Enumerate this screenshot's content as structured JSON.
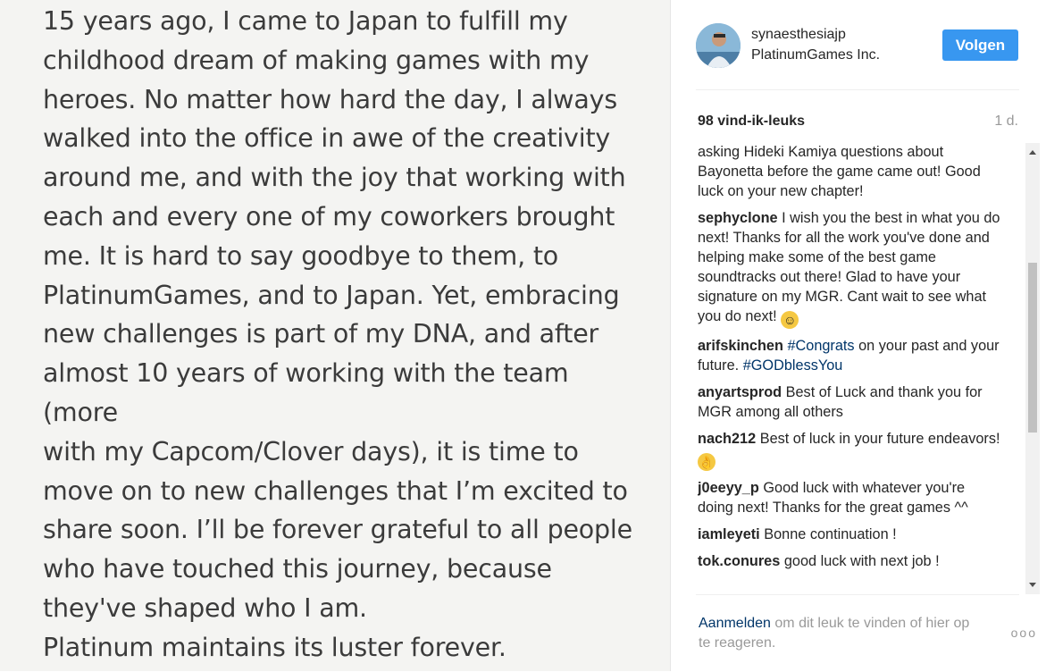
{
  "post": {
    "paragraph1": "15 years ago, I came to Japan to fulfill my\nchildhood dream of making games with my\nheroes. No matter how hard the day, I always\nwalked into the office in awe of the creativity\naround me, and with the joy that working with\neach and every one of my coworkers brought\nme. It is hard to say goodbye to them, to\nPlatinumGames, and to Japan. Yet, embracing\nnew challenges is part of my DNA, and after\nalmost 10 years of working with the team (more\nwith my Capcom/Clover days), it is time to\nmove on to new challenges that I’m excited to\nshare soon. I’ll be forever grateful to all people\nwho have touched this journey, because\nthey've shaped who I am.",
    "paragraph2": "Platinum maintains its luster forever."
  },
  "header": {
    "username": "synaesthesiajp",
    "location": "PlatinumGames Inc.",
    "follow_label": "Volgen"
  },
  "stats": {
    "likes": "98 vind-ik-leuks",
    "ago": "1 d."
  },
  "comments": [
    {
      "user": "",
      "text": "asking Hideki Kamiya questions about Bayonetta before the game came out! Good luck on your new chapter!"
    },
    {
      "user": "sephyclone",
      "text": "I wish you the best in what you do next! Thanks for all the work you've done and helping make some of the best game soundtracks out there! Glad to have your signature on my MGR. Cant wait to see what you do next!"
    },
    {
      "user": "arifskinchen",
      "tag1": "#Congrats",
      "text_mid": "on your past and your future.",
      "tag2": "#GODblessYou"
    },
    {
      "user": "anyartsprod",
      "text": "Best of Luck and thank you for MGR among all others"
    },
    {
      "user": "nach212",
      "text": "Best of luck in your future endeavors!"
    },
    {
      "user": "j0eeyy_p",
      "text": "Good luck with whatever you're doing next! Thanks for the great games ^^"
    },
    {
      "user": "iamleyeti",
      "text": "Bonne continuation !"
    },
    {
      "user": "tok.conures",
      "text": "good luck with next job !"
    }
  ],
  "footer": {
    "login_label": "Aanmelden",
    "prompt": "om dit leuk te vinden of hier op te reageren.",
    "more_icon": "ooo"
  },
  "colors": {
    "accent": "#3897f0",
    "link": "#003569"
  }
}
